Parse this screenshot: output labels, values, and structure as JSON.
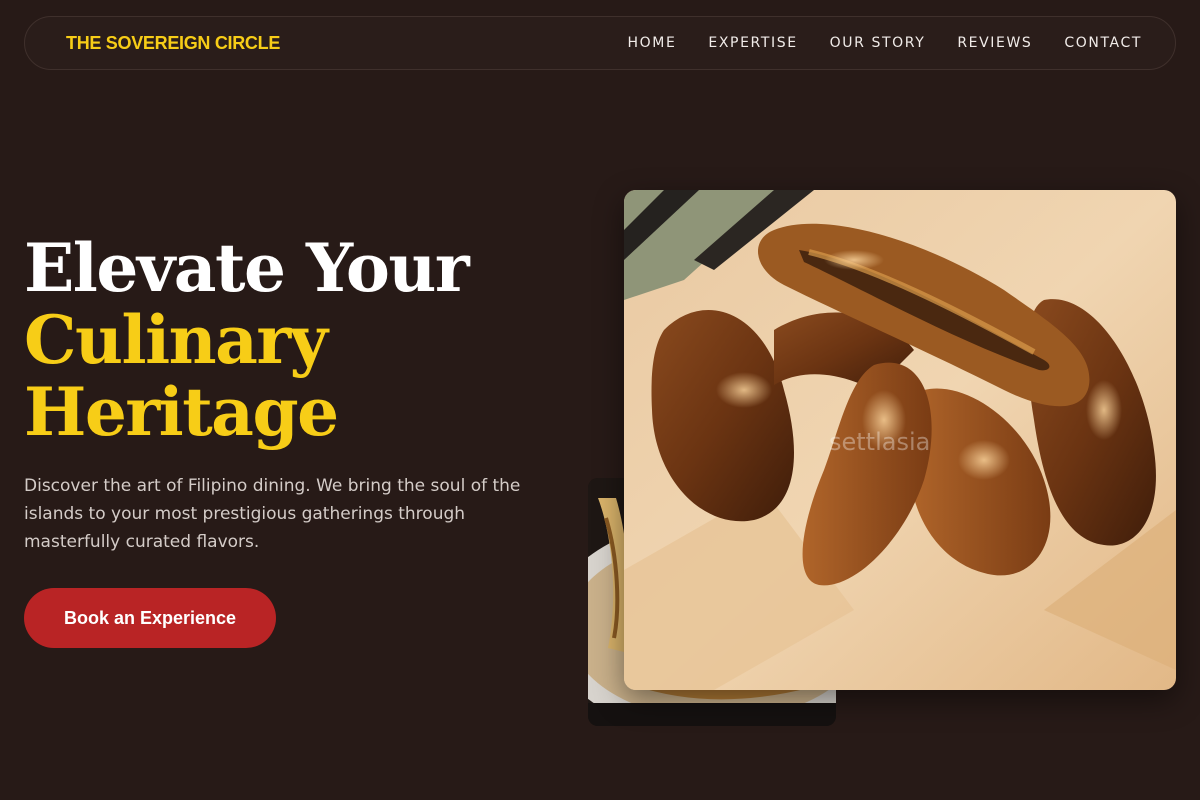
{
  "nav": {
    "brand": "THE SOVEREIGN CIRCLE",
    "links": [
      "HOME",
      "EXPERTISE",
      "OUR STORY",
      "REVIEWS",
      "CONTACT"
    ]
  },
  "hero": {
    "title_line1": "Elevate Your",
    "title_line2": "Culinary",
    "title_line3": "Heritage",
    "description": "Discover the art of Filipino dining. We bring the soul of the islands to your most prestigious gatherings through masterfully curated flavors.",
    "cta_label": "Book an Experience"
  },
  "images": {
    "main_watermark": "settlasia"
  },
  "colors": {
    "background": "#271a17",
    "accent_gold": "#f7cd17",
    "cta_red": "#b92425"
  }
}
